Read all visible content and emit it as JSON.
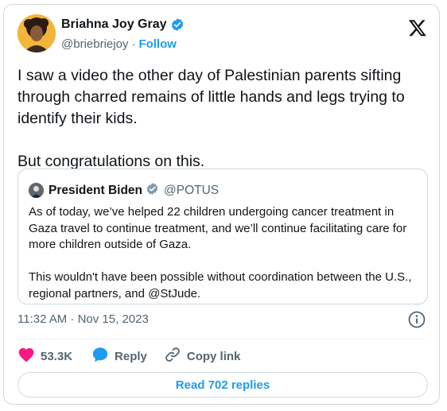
{
  "author": {
    "name": "Briahna Joy Gray",
    "handle": "@briebriejoy",
    "separator": "·",
    "follow_label": "Follow"
  },
  "tweet": {
    "text": "I saw a video the other day of Palestinian parents sifting through charred remains of little hands and legs trying to identify their kids.\n\nBut congratulations on this."
  },
  "quoted": {
    "name": "President Biden",
    "handle": "@POTUS",
    "text": "As of today, we’ve helped 22 children undergoing cancer treatment in Gaza travel to continue treatment, and we’ll continue facilitating care for more children outside of Gaza.\n\nThis wouldn't have been possible without coordination between the U.S., regional partners, and @StJude."
  },
  "meta": {
    "timestamp": "11:32 AM · Nov 15, 2023"
  },
  "actions": {
    "likes": "53.3K",
    "reply_label": "Reply",
    "copy_label": "Copy link"
  },
  "footer": {
    "read_replies": "Read 702 replies"
  },
  "colors": {
    "accent": "#1d9bf0",
    "like": "#f91880",
    "muted": "#536471",
    "text": "#0f1419",
    "border": "#cfd9de"
  },
  "icons": [
    "verified-badge-icon",
    "x-logo-icon",
    "info-icon",
    "heart-icon",
    "reply-bubble-icon",
    "link-icon"
  ]
}
